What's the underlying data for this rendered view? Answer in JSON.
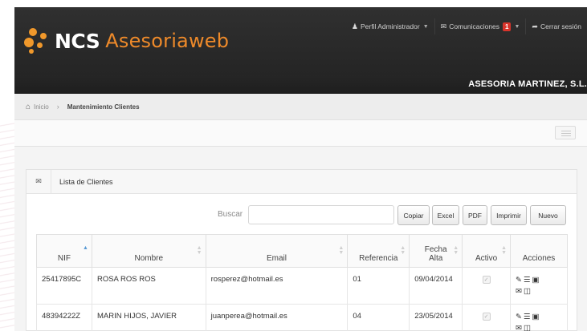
{
  "brand": {
    "bold": "NCS",
    "light": "Asesoriaweb",
    "accent": "#ee8a2a"
  },
  "topbar": {
    "profile": {
      "icon": "user-icon",
      "label": "Perfil Administrador"
    },
    "messages": {
      "icon": "envelope-icon",
      "label": "Comunicaciones",
      "count": "1"
    },
    "logout": {
      "icon": "share-arrow-icon",
      "label": "Cerrar sesión"
    }
  },
  "company": "ASESORIA MARTINEZ, S.L.",
  "breadcrumb": {
    "home": "Inicio",
    "current": "Mantenimiento Clientes"
  },
  "panel": {
    "title": "Lista de Clientes"
  },
  "search": {
    "label": "Buscar",
    "value": ""
  },
  "buttons": {
    "copy": "Copiar",
    "excel": "Excel",
    "pdf": "PDF",
    "print": "Imprimir",
    "new": "Nuevo"
  },
  "table": {
    "headers": {
      "nif": "NIF",
      "nombre": "Nombre",
      "email": "Email",
      "referencia": "Referencia",
      "fecha_line1": "Fecha",
      "fecha_line2": "Alta",
      "activo": "Activo",
      "acciones": "Acciones"
    },
    "rows": [
      {
        "nif": "25417895C",
        "nombre": "ROSA ROS ROS",
        "email": "rosperez@hotmail.es",
        "referencia": "01",
        "fecha": "09/04/2014",
        "activo": true
      },
      {
        "nif": "48394222Z",
        "nombre": "MARIN HIJOS, JAVIER",
        "email": "juanperea@hotmail.es",
        "referencia": "04",
        "fecha": "23/05/2014",
        "activo": true
      }
    ]
  }
}
